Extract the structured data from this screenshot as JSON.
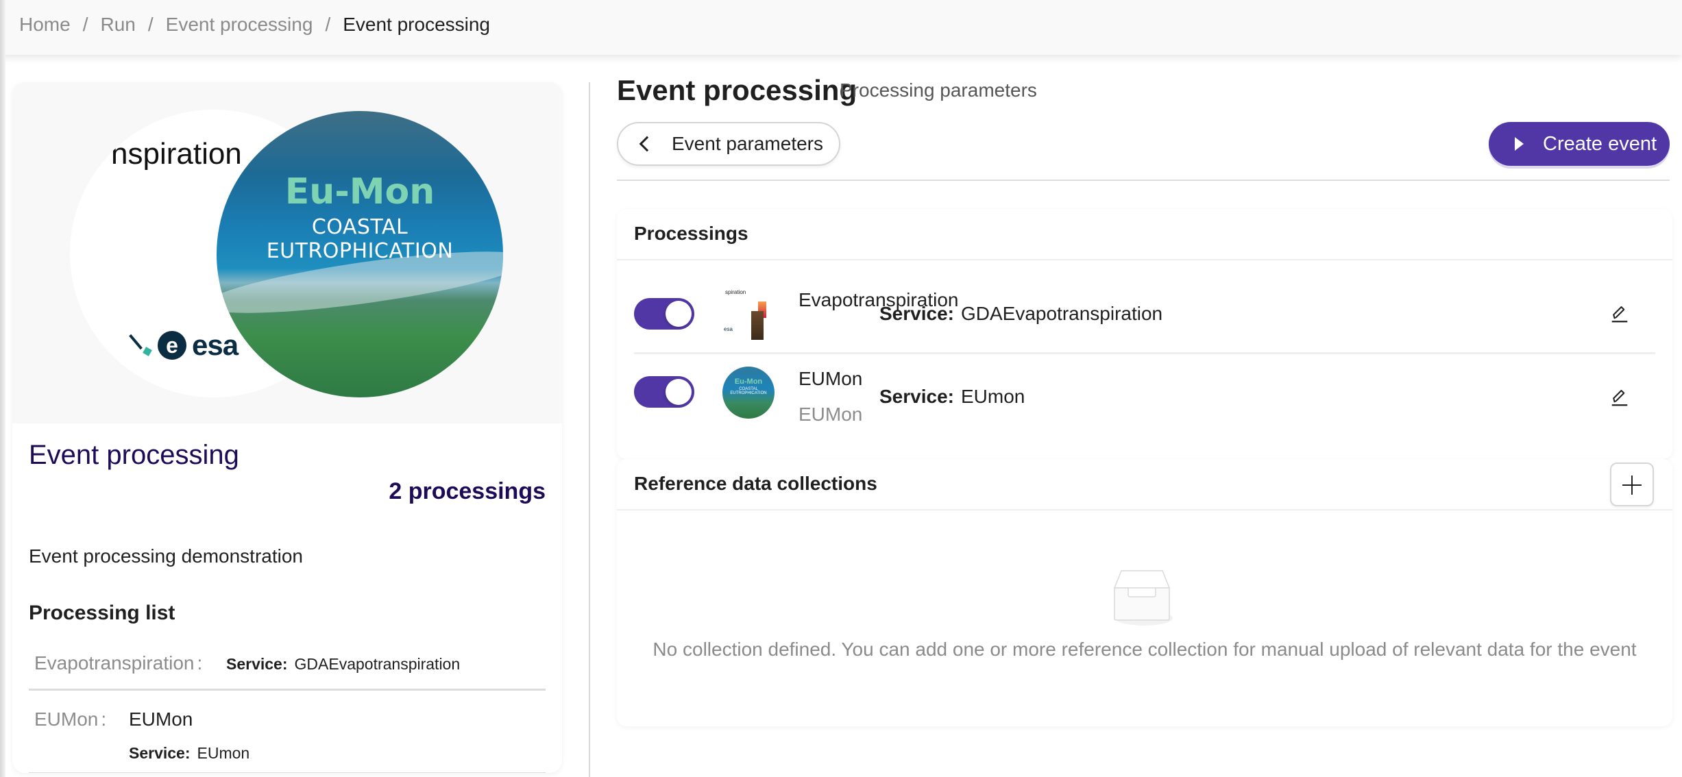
{
  "breadcrumb": [
    {
      "label": "Home"
    },
    {
      "label": "Run"
    },
    {
      "label": "Event processing"
    },
    {
      "label": "Event processing",
      "current": true
    }
  ],
  "left_panel": {
    "hero": {
      "evapo_partial_text": "nspiration",
      "esa_logo_text": "esa",
      "esa_logo_mark": "e",
      "eumon_title": "Eu-Mon",
      "eumon_subtitle": "COASTAL EUTROPHICATION"
    },
    "title": "Event processing",
    "count": "2 processings",
    "description": "Event processing demonstration",
    "list_title": "Processing list",
    "list": [
      {
        "label": "Evapotranspiration",
        "colon": ":",
        "name": "",
        "service_label": "Service:",
        "service": "GDAEvapotranspiration"
      },
      {
        "label": "EUMon",
        "colon": ":",
        "name": "EUMon",
        "service_label": "Service:",
        "service": "EUmon"
      }
    ]
  },
  "header": {
    "title": "Event processing",
    "subtitle": "Processing parameters",
    "back_button": "Event parameters",
    "create_button": "Create event"
  },
  "processings": {
    "title": "Processings",
    "items": [
      {
        "name": "Evapotranspiration",
        "secondary": "",
        "service_label": "Service:",
        "service": "GDAEvapotranspiration",
        "enabled": true,
        "thumb_text_top": "spiration",
        "thumb_text_bottom": "esa"
      },
      {
        "name": "EUMon",
        "secondary": "EUMon",
        "service_label": "Service:",
        "service": "EUmon",
        "enabled": true,
        "thumb_text_top": "Eu-Mon",
        "thumb_text_bottom": "COASTAL EUTROPHICATION"
      }
    ]
  },
  "reference": {
    "title": "Reference data collections",
    "empty_text": "No collection defined. You can add one or more reference collection for manual upload of relevant data for the event"
  },
  "colors": {
    "accent": "#5137a6",
    "title_dark": "#1e0b57",
    "muted": "#8a8a8a"
  }
}
